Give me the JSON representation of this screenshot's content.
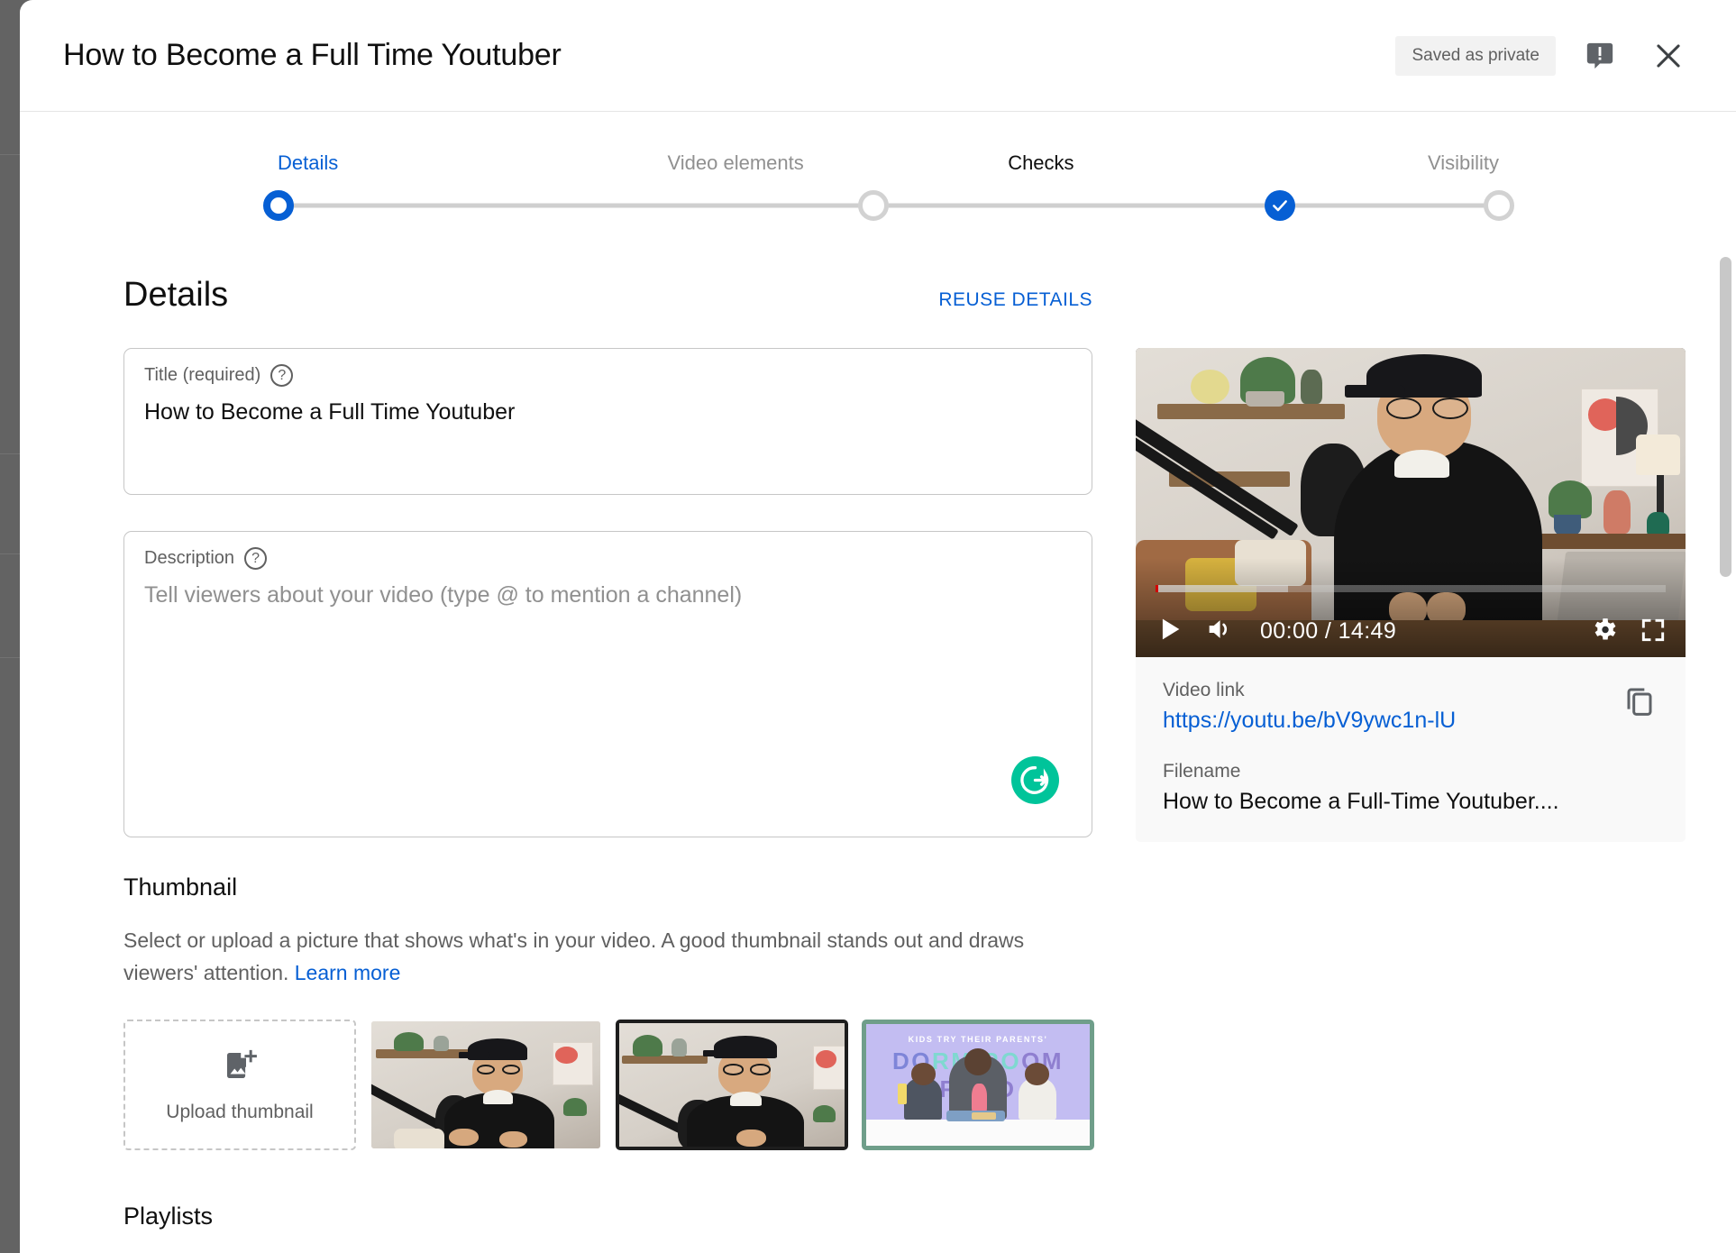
{
  "header": {
    "title": "How to Become a Full Time Youtuber",
    "saved_status": "Saved as private",
    "feedback_icon": "feedback-speech-bubble-icon",
    "close_icon": "close-icon"
  },
  "stepper": {
    "steps": [
      {
        "label": "Details",
        "state": "active"
      },
      {
        "label": "Video elements",
        "state": "idle"
      },
      {
        "label": "Checks",
        "state": "complete"
      },
      {
        "label": "Visibility",
        "state": "idle"
      }
    ],
    "active_color": "#065fd4",
    "idle_color": "#909090",
    "line_color": "#cfcfcf"
  },
  "details": {
    "section_title": "Details",
    "reuse_label": "REUSE DETAILS",
    "title_field": {
      "label": "Title (required)",
      "value": "How to Become a Full Time Youtuber",
      "help_icon": "help-circle-icon"
    },
    "description_field": {
      "label": "Description",
      "placeholder": "Tell viewers about your video (type @ to mention a channel)",
      "value": "",
      "help_icon": "help-circle-icon",
      "assistant_icon": "grammarly-icon",
      "assistant_color": "#00c49a"
    }
  },
  "thumbnail": {
    "title": "Thumbnail",
    "description_before_link": "Select or upload a picture that shows what's in your video. A good thumbnail stands out and draws viewers' attention. ",
    "learn_more": "Learn more",
    "upload": {
      "label": "Upload thumbnail",
      "icon": "add-image-icon"
    },
    "options": [
      {
        "name": "auto-generated-frame-1",
        "state": "unselected"
      },
      {
        "name": "auto-generated-frame-2",
        "state": "hover"
      },
      {
        "name": "custom-thumbnail-dorm-room-food",
        "state": "selected",
        "kicker": "KIDS TRY THEIR PARENTS'",
        "headline_part1": "DO",
        "headline_part2": "RM RO",
        "headline_part3": "OM FOOD",
        "selected_border_color": "#6f9e8a"
      }
    ]
  },
  "playlists": {
    "title": "Playlists"
  },
  "preview": {
    "player": {
      "play_icon": "play-icon",
      "volume_icon": "volume-icon",
      "time": "00:00 / 14:49",
      "settings_icon": "gear-icon",
      "fullscreen_icon": "fullscreen-icon",
      "progress_played_percent": 0.6,
      "progress_buffered_percent": 26
    },
    "video_link_label": "Video link",
    "video_link": "https://youtu.be/bV9ywc1n-lU",
    "filename_label": "Filename",
    "filename": "How to Become a Full-Time Youtuber....",
    "copy_icon": "copy-icon"
  },
  "scrollbar": {
    "name": "vertical-scrollbar"
  }
}
